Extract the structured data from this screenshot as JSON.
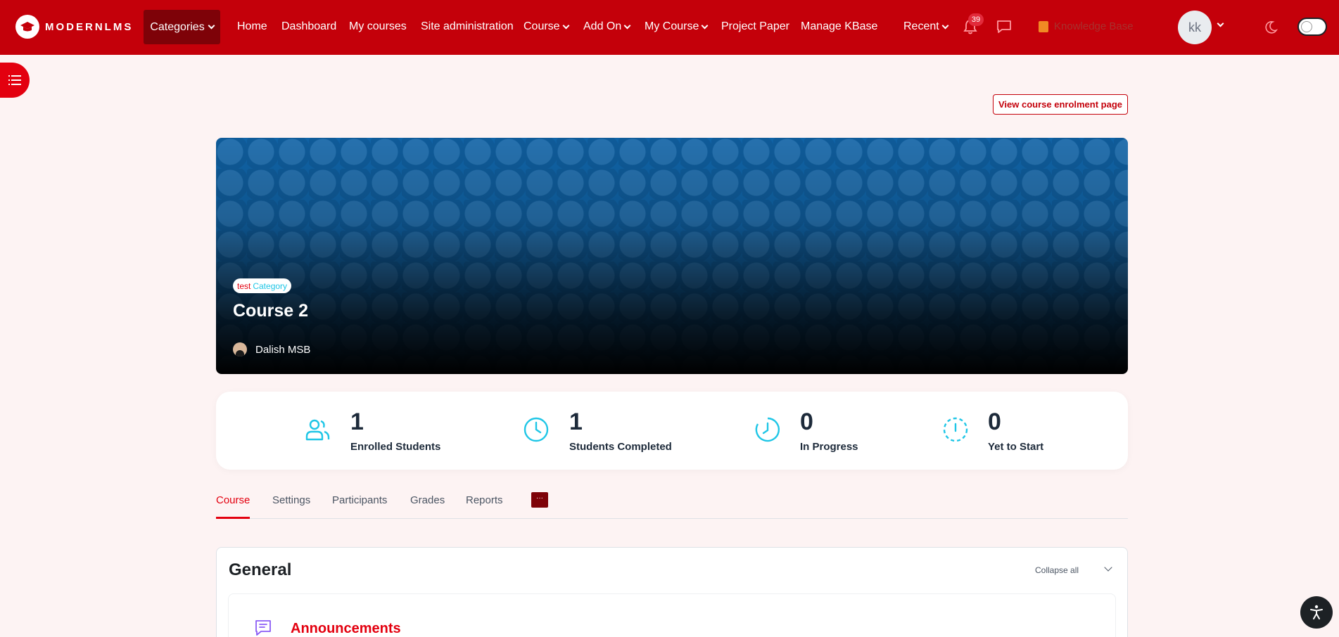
{
  "header": {
    "logo_text": "MODERNLMS",
    "nav": {
      "categories": "Categories",
      "home": "Home",
      "dashboard": "Dashboard",
      "my_courses": "My courses",
      "site_admin": "Site administration",
      "course": "Course",
      "add_on": "Add On",
      "my_course": "My Course",
      "project_paper": "Project Paper",
      "manage_kbase": "Manage KBase",
      "recent": "Recent"
    },
    "notifications_count": "39",
    "knowledge_base": "Knowledge Base",
    "user_initials": "kk"
  },
  "enrol_button": "View course enrolment page",
  "hero": {
    "badge_part1": "test",
    "badge_part2": "Category",
    "course_title": "Course 2",
    "teacher": "Dalish MSB"
  },
  "stats": [
    {
      "value": "1",
      "label": "Enrolled Students"
    },
    {
      "value": "1",
      "label": "Students Completed"
    },
    {
      "value": "0",
      "label": "In Progress"
    },
    {
      "value": "0",
      "label": "Yet to Start"
    }
  ],
  "tabs": {
    "course": "Course",
    "settings": "Settings",
    "participants": "Participants",
    "grades": "Grades",
    "reports": "Reports",
    "more": "···"
  },
  "section": {
    "title": "General",
    "collapse_all": "Collapse all",
    "activity_name": "Announcements"
  },
  "colors": {
    "brand_red": "#c4000a",
    "accent_cyan": "#1fc6e6"
  }
}
